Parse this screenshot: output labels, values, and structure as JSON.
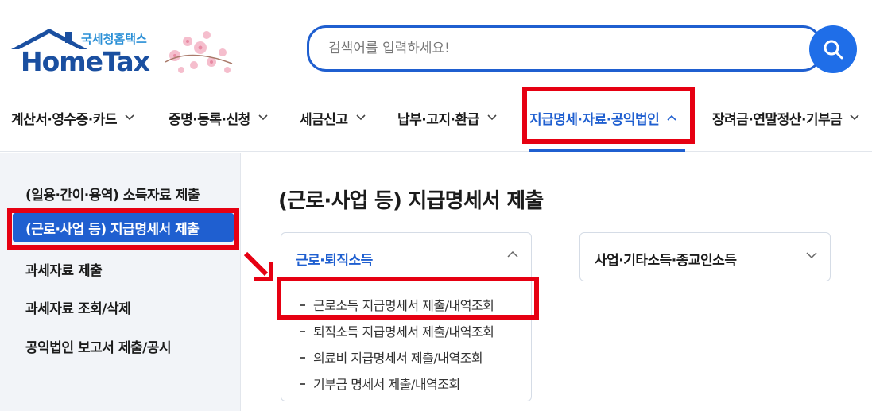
{
  "brand": {
    "sub_name": "국세청홈택스",
    "name": "HomeTax"
  },
  "search": {
    "placeholder": "검색어를 입력하세요!",
    "button_icon": "search-icon"
  },
  "nav": {
    "items": [
      {
        "label": "계산서·영수증·카드",
        "active": false
      },
      {
        "label": "증명·등록·신청",
        "active": false
      },
      {
        "label": "세금신고",
        "active": false
      },
      {
        "label": "납부·고지·환급",
        "active": false
      },
      {
        "label": "지급명세·자료·공익법인",
        "active": true
      },
      {
        "label": "장려금·연말정산·기부금",
        "active": false
      }
    ]
  },
  "sidebar": {
    "items": [
      {
        "label": "(일용·간이·용역) 소득자료 제출",
        "active": false
      },
      {
        "label": "(근로·사업 등) 지급명세서 제출",
        "active": true
      },
      {
        "label": "과세자료 제출",
        "active": false
      },
      {
        "label": "과세자료 조회/삭제",
        "active": false
      },
      {
        "label": "공익법인 보고서 제출/공시",
        "active": false
      }
    ]
  },
  "main": {
    "title": "(근로·사업 등) 지급명세서 제출",
    "cards": [
      {
        "title": "근로·퇴직소득",
        "expanded": true,
        "items": [
          "근로소득 지급명세서 제출/내역조회",
          "퇴직소득 지급명세서 제출/내역조회",
          "의료비 지급명세서 제출/내역조회",
          "기부금 명세서 제출/내역조회"
        ]
      },
      {
        "title": "사업·기타소득·종교인소득",
        "expanded": false,
        "items": []
      }
    ]
  },
  "colors": {
    "accent": "#1f5fd0",
    "highlight_box": "#e60012",
    "sidebar_bg": "#f2f4f8"
  }
}
